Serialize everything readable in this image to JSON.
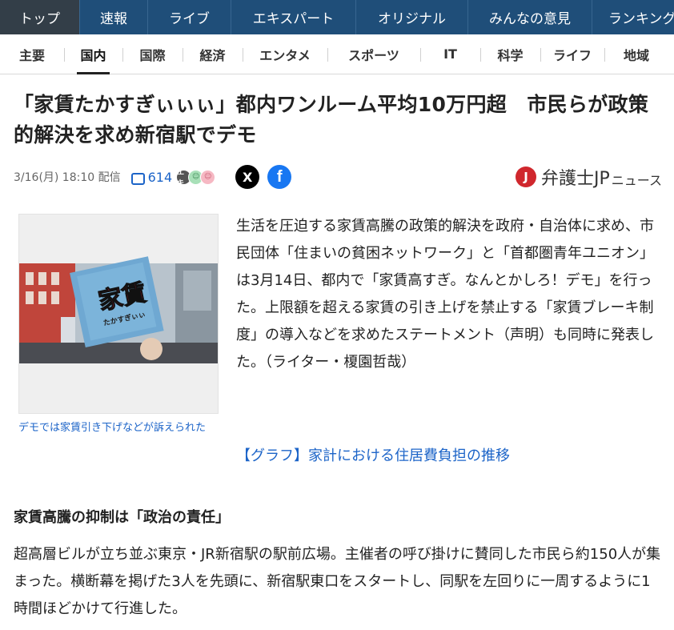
{
  "top_nav": [
    {
      "label": "トップ",
      "active": true
    },
    {
      "label": "速報"
    },
    {
      "label": "ライブ"
    },
    {
      "label": "エキスパート"
    },
    {
      "label": "オリジナル"
    },
    {
      "label": "みんなの意見"
    },
    {
      "label": "ランキング"
    }
  ],
  "category_nav": [
    {
      "label": "主要"
    },
    {
      "label": "国内",
      "active": true
    },
    {
      "label": "国際"
    },
    {
      "label": "経済"
    },
    {
      "label": "エンタメ"
    },
    {
      "label": "スポーツ"
    },
    {
      "label": "IT"
    },
    {
      "label": "科学"
    },
    {
      "label": "ライフ"
    },
    {
      "label": "地域"
    }
  ],
  "article": {
    "headline": "「家賃たかすぎぃぃぃ」都内ワンルーム平均10万円超　市民らが政策的解決を求め新宿駅でデモ",
    "date": "3/16(月) 18:10 配信",
    "comment_count": "614",
    "reactions": [
      "エキ",
      "☺",
      "☺"
    ],
    "share_x": "X",
    "share_facebook": "f",
    "source_mark": "J",
    "source_name": "弁護士JP",
    "source_suffix": "ニュース",
    "photo_sign_text": "家賃",
    "photo_sign_subtext": "たかすぎぃぃ",
    "photo_caption": "デモでは家賃引き下げなどが訴えられた",
    "lead": "生活を圧迫する家賃高騰の政策的解決を政府・自治体に求め、市民団体「住まいの貧困ネットワーク」と「首都圏青年ユニオン」は3月14日、都内で「家賃高すぎ。なんとかしろ！デモ」を行った。上限額を超える家賃の引き上げを禁止する「家賃ブレーキ制度」の導入などを求めたステートメント（声明）も同時に発表した。（ライター・榎園哲哉）",
    "graph_link": "【グラフ】家計における住居費負担の推移",
    "subheading": "家賃高騰の抑制は「政治の責任」",
    "body": "超高層ビルが立ち並ぶ東京・JR新宿駅の駅前広場。主催者の呼び掛けに賛同した市民ら約150人が集まった。横断幕を掲げた3人を先頭に、新宿駅東口をスタートし、同駅を左回りに一周するように1時間ほどかけて行進した。"
  },
  "colors": {
    "top_nav_bg": "#1f4e79",
    "top_nav_active_bg": "#333e48",
    "link_blue": "#1c64c8",
    "source_red": "#d0272d"
  }
}
